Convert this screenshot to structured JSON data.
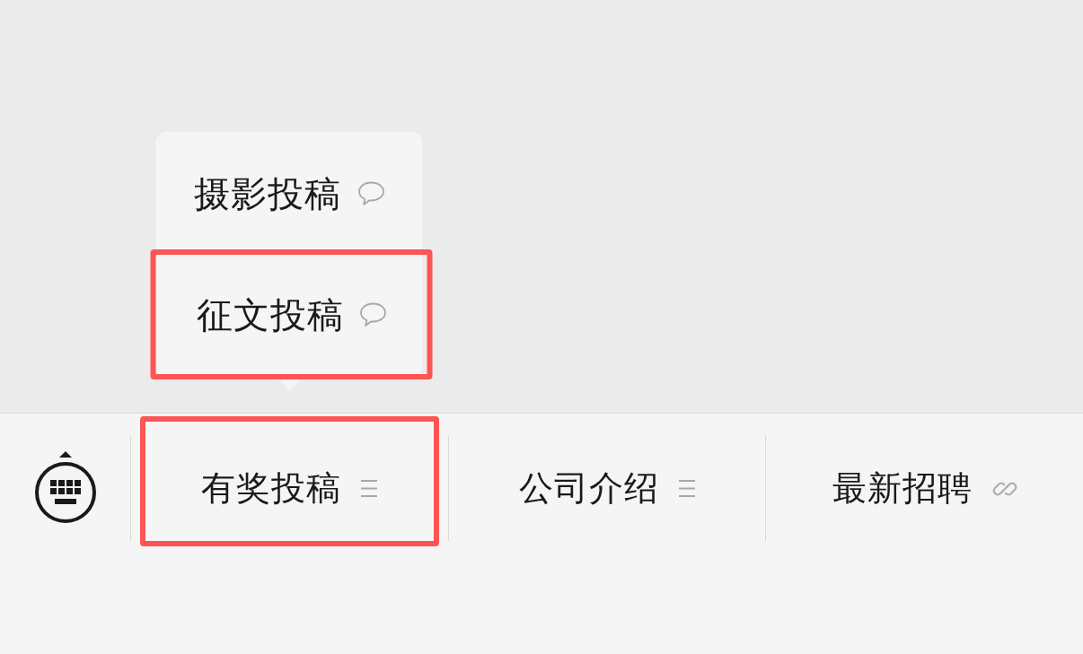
{
  "menu_bar": {
    "items": [
      {
        "label": "有奖投稿",
        "kind": "submenu",
        "expanded": true,
        "highlighted": true,
        "sub_items": [
          {
            "label": "摄影投稿",
            "kind": "message",
            "highlighted": false
          },
          {
            "label": "征文投稿",
            "kind": "message",
            "highlighted": true
          }
        ]
      },
      {
        "label": "公司介绍",
        "kind": "submenu",
        "expanded": false,
        "highlighted": false
      },
      {
        "label": "最新招聘",
        "kind": "link",
        "highlighted": false
      }
    ]
  }
}
